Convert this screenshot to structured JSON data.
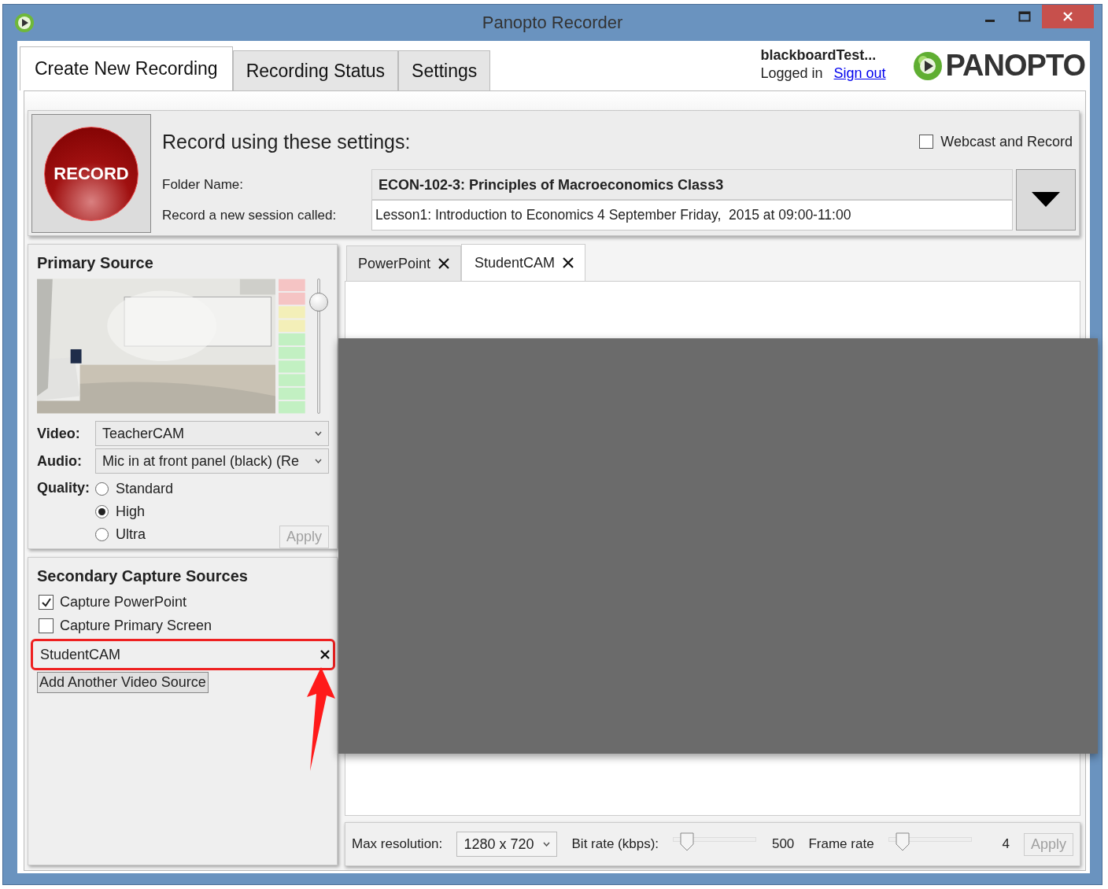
{
  "window": {
    "title": "Panopto Recorder"
  },
  "tabs": [
    {
      "label": "Create New Recording",
      "selected": true
    },
    {
      "label": "Recording Status",
      "selected": false
    },
    {
      "label": "Settings",
      "selected": false
    }
  ],
  "account": {
    "user": "blackboardTest...",
    "status": "Logged in",
    "link": "Sign out"
  },
  "logo": {
    "text": "PANOPTO"
  },
  "record_button": {
    "label": "RECORD"
  },
  "settings": {
    "heading": "Record using these settings:",
    "webcast": {
      "label": "Webcast and Record",
      "checked": false
    },
    "folder": {
      "label": "Folder Name:",
      "value": "ECON-102-3: Principles of Macroeconomics Class3"
    },
    "session": {
      "label": "Record a new session called:",
      "value": "Lesson1: Introduction to Economics 4 September Friday,  2015 at 09:00-11:00"
    }
  },
  "primary_source": {
    "heading": "Primary Source",
    "volume": {
      "level": 0.88
    },
    "video": {
      "label": "Video:",
      "value": "TeacherCAM"
    },
    "audio": {
      "label": "Audio:",
      "value": "Mic in at front panel (black) (Re"
    },
    "quality": {
      "label": "Quality:",
      "options": [
        {
          "label": "Standard",
          "selected": false
        },
        {
          "label": "High",
          "selected": true
        },
        {
          "label": "Ultra",
          "selected": false
        }
      ]
    },
    "apply": {
      "label": "Apply",
      "disabled": true
    }
  },
  "secondary_sources": {
    "heading": "Secondary Capture Sources",
    "options": [
      {
        "label": "Capture PowerPoint",
        "checked": true
      },
      {
        "label": "Capture Primary Screen",
        "checked": false
      }
    ],
    "sources": [
      {
        "name": "StudentCAM",
        "highlighted": true
      }
    ],
    "add_button": "Add Another Video Source"
  },
  "source_tabs": [
    {
      "label": "PowerPoint",
      "selected": false
    },
    {
      "label": "StudentCAM",
      "selected": true
    }
  ],
  "video_settings": {
    "resolution": {
      "label": "Max resolution:",
      "value": "1280 x 720"
    },
    "bit_rate": {
      "label": "Bit rate (kbps):",
      "level": 0.1,
      "value": "500"
    },
    "frame_rate": {
      "label": "Frame rate",
      "level": 0.1,
      "value": "4"
    },
    "apply": {
      "label": "Apply",
      "disabled": true
    }
  }
}
